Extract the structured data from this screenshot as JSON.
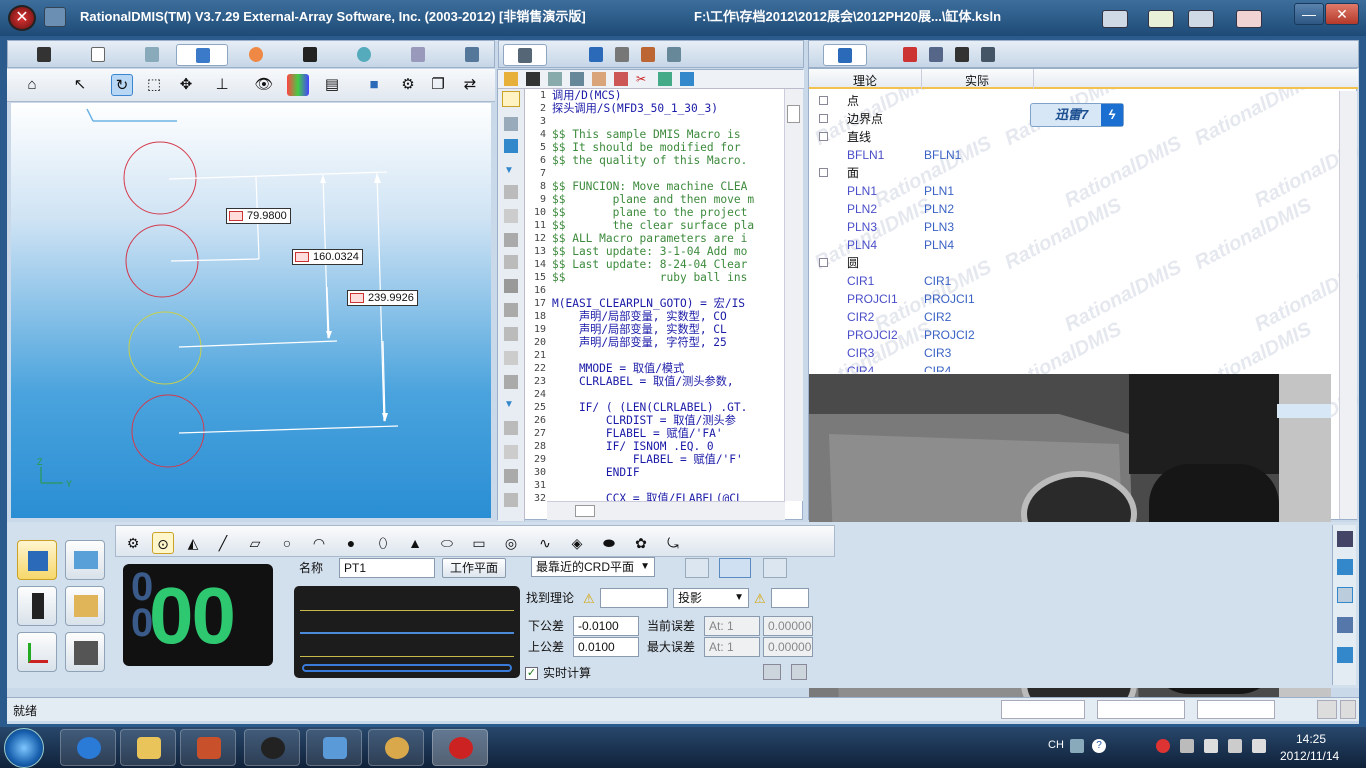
{
  "window": {
    "title": "RationalDMIS(TM) V3.7.29    External-Array Software, Inc. (2003-2012) [非销售演示版]",
    "file_path": "F:\\工作\\存档2012\\2012展会\\2012PH20展...\\缸体.ksln",
    "minimize": "—",
    "restore": "▭",
    "close": "✕"
  },
  "graphics": {
    "dimensions": [
      "79.9800",
      "160.0324",
      "239.9926"
    ],
    "axis_labels": {
      "x": "X",
      "y": "Y",
      "z": "Z"
    }
  },
  "editor": {
    "line_numbers": [
      "1",
      "2",
      "3",
      "4",
      "5",
      "6",
      "7",
      "8",
      "9",
      "10",
      "11",
      "12",
      "13",
      "14",
      "15",
      "16",
      "17",
      "18",
      "19",
      "20",
      "21",
      "22",
      "23",
      "24",
      "25",
      "26",
      "27",
      "28",
      "29",
      "30",
      "31",
      "32"
    ],
    "lines": [
      "调用/D(MCS)",
      "探头调用/S(MFD3_50_1_30_3)",
      "",
      "$$ This sample DMIS Macro is",
      "$$ It should be modified for",
      "$$ the quality of this Macro.",
      "",
      "$$ FUNCION: Move machine CLEA",
      "$$       plane and then move m",
      "$$       plane to the project",
      "$$       the clear surface pla",
      "$$ ALL Macro parameters are i",
      "$$ Last update: 3-1-04 Add mo",
      "$$ Last update: 8-24-04 Clear",
      "$$              ruby ball ins",
      "",
      "M(EASI_CLEARPLN_GOTO) = 宏/IS",
      "    声明/局部变量, 实数型, CO",
      "    声明/局部变量, 实数型, CL",
      "    声明/局部变量, 字符型, 25",
      "",
      "    MMODE = 取值/模式",
      "    CLRLABEL = 取值/测头参数,",
      "",
      "    IF/ ( (LEN(CLRLABEL) .GT.",
      "        CLRDIST = 取值/测头参",
      "        FLABEL = 赋值/'FA'",
      "        IF/ ISNOM .EQ. 0",
      "            FLABEL = 赋值/'F'",
      "        ENDIF",
      "",
      "        CCX = 取值/FLABEL(@CL"
    ]
  },
  "tree": {
    "col_nominal": "理论",
    "col_actual": "实际",
    "rows": [
      {
        "label": "点",
        "nominal": "",
        "actual": "",
        "group": true
      },
      {
        "label": "边界点",
        "nominal": "",
        "actual": "",
        "group": true
      },
      {
        "label": "直线",
        "nominal": "",
        "actual": "",
        "group": true
      },
      {
        "label": "",
        "nominal": "BFLN1",
        "actual": "BFLN1",
        "group": false
      },
      {
        "label": "面",
        "nominal": "",
        "actual": "",
        "group": true
      },
      {
        "label": "",
        "nominal": "PLN1",
        "actual": "PLN1",
        "group": false
      },
      {
        "label": "",
        "nominal": "PLN2",
        "actual": "PLN2",
        "group": false
      },
      {
        "label": "",
        "nominal": "PLN3",
        "actual": "PLN3",
        "group": false
      },
      {
        "label": "",
        "nominal": "PLN4",
        "actual": "PLN4",
        "group": false
      },
      {
        "label": "圆",
        "nominal": "",
        "actual": "",
        "group": true
      },
      {
        "label": "",
        "nominal": "CIR1",
        "actual": "CIR1",
        "group": false
      },
      {
        "label": "",
        "nominal": "PROJCI1",
        "actual": "PROJCI1",
        "group": false
      },
      {
        "label": "",
        "nominal": "CIR2",
        "actual": "CIR2",
        "group": false
      },
      {
        "label": "",
        "nominal": "PROJCI2",
        "actual": "PROJCI2",
        "group": false
      },
      {
        "label": "",
        "nominal": "CIR3",
        "actual": "CIR3",
        "group": false
      },
      {
        "label": "",
        "nominal": "CIR4",
        "actual": "CIR4",
        "group": false
      }
    ],
    "watermark": "RationalDMIS"
  },
  "xunlei": {
    "text": "迅雷7",
    "symbol": "ϟ"
  },
  "measure": {
    "counter_value": "00",
    "counter_ghost": "0",
    "name_label": "名称",
    "name_value": "PT1",
    "workplane_button": "工作平面",
    "crd_plane": "最靠近的CRD平面",
    "find_nominal": "找到理论",
    "projection": "投影",
    "lower_tol_label": "下公差",
    "lower_tol": "-0.0100",
    "upper_tol_label": "上公差",
    "upper_tol": "0.0100",
    "current_err_label": "当前误差",
    "current_err": "At: 1",
    "current_err_val": "0.00000",
    "max_err_label": "最大误差",
    "max_err": "At: 1",
    "max_err_val": "0.00000",
    "realtime_label": "实时计算",
    "realtime_checked": true
  },
  "status": {
    "text": "就绪"
  },
  "taskbar": {
    "time": "14:25",
    "date": "2012/11/14",
    "lang": "CH"
  }
}
